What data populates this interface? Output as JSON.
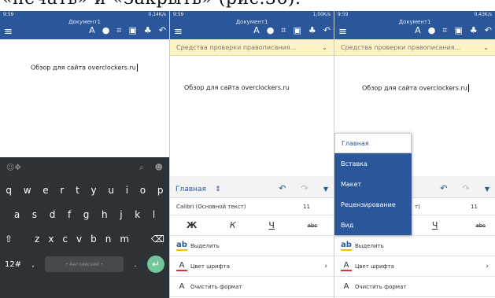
{
  "caption": "«печать» и «Закрыть» (рис.36).",
  "panels": [
    {
      "status_time": "9:59",
      "status_net": "0,14K/s",
      "doc_title": "Документ1",
      "doc_text": "Обзор для сайта overclockers.ru",
      "keyboard": {
        "row1": [
          "q",
          "w",
          "e",
          "r",
          "t",
          "y",
          "u",
          "i",
          "o",
          "p"
        ],
        "row2": [
          "a",
          "s",
          "d",
          "f",
          "g",
          "h",
          "j",
          "k",
          "l"
        ],
        "row3": [
          "z",
          "x",
          "c",
          "v",
          "b",
          "n",
          "m"
        ],
        "num_key": "12#",
        "comma_key": ",",
        "space_label": "• Английский •",
        "period_key": "."
      }
    },
    {
      "status_time": "9:59",
      "status_net": "1,00K/s",
      "doc_title": "Документ1",
      "spell_label": "Средства проверки правописания...",
      "doc_text": "Обзор для сайта overclockers.ru",
      "ribbon": {
        "tab": "Главная",
        "font": "Calibri (Основной текст)",
        "size": "11",
        "bold": "Ж",
        "italic": "К",
        "underline": "Ч",
        "strike": "abc",
        "highlight": "Выделить",
        "font_color": "Цвет шрифта",
        "clear_format": "Очистить формат"
      }
    },
    {
      "status_time": "9:59",
      "status_net": "0,43K/s",
      "doc_title": "Документ1",
      "spell_label": "Средства проверки правописания...",
      "doc_text": "Обзор для сайта overclockers.ru",
      "ribbon": {
        "font_tail": "т)",
        "size": "11",
        "underline": "Ч",
        "strike": "abc",
        "highlight": "Выделить",
        "font_color": "Цвет шрифта",
        "clear_format": "Очистить формат"
      },
      "menu": [
        "Главная",
        "Вставка",
        "Макет",
        "Рецензирование",
        "Вид"
      ]
    }
  ],
  "colors": {
    "accent": "#2b579a",
    "spell_bar": "#fff3c4",
    "keyboard": "#2d3236",
    "enter": "#74c69d"
  }
}
